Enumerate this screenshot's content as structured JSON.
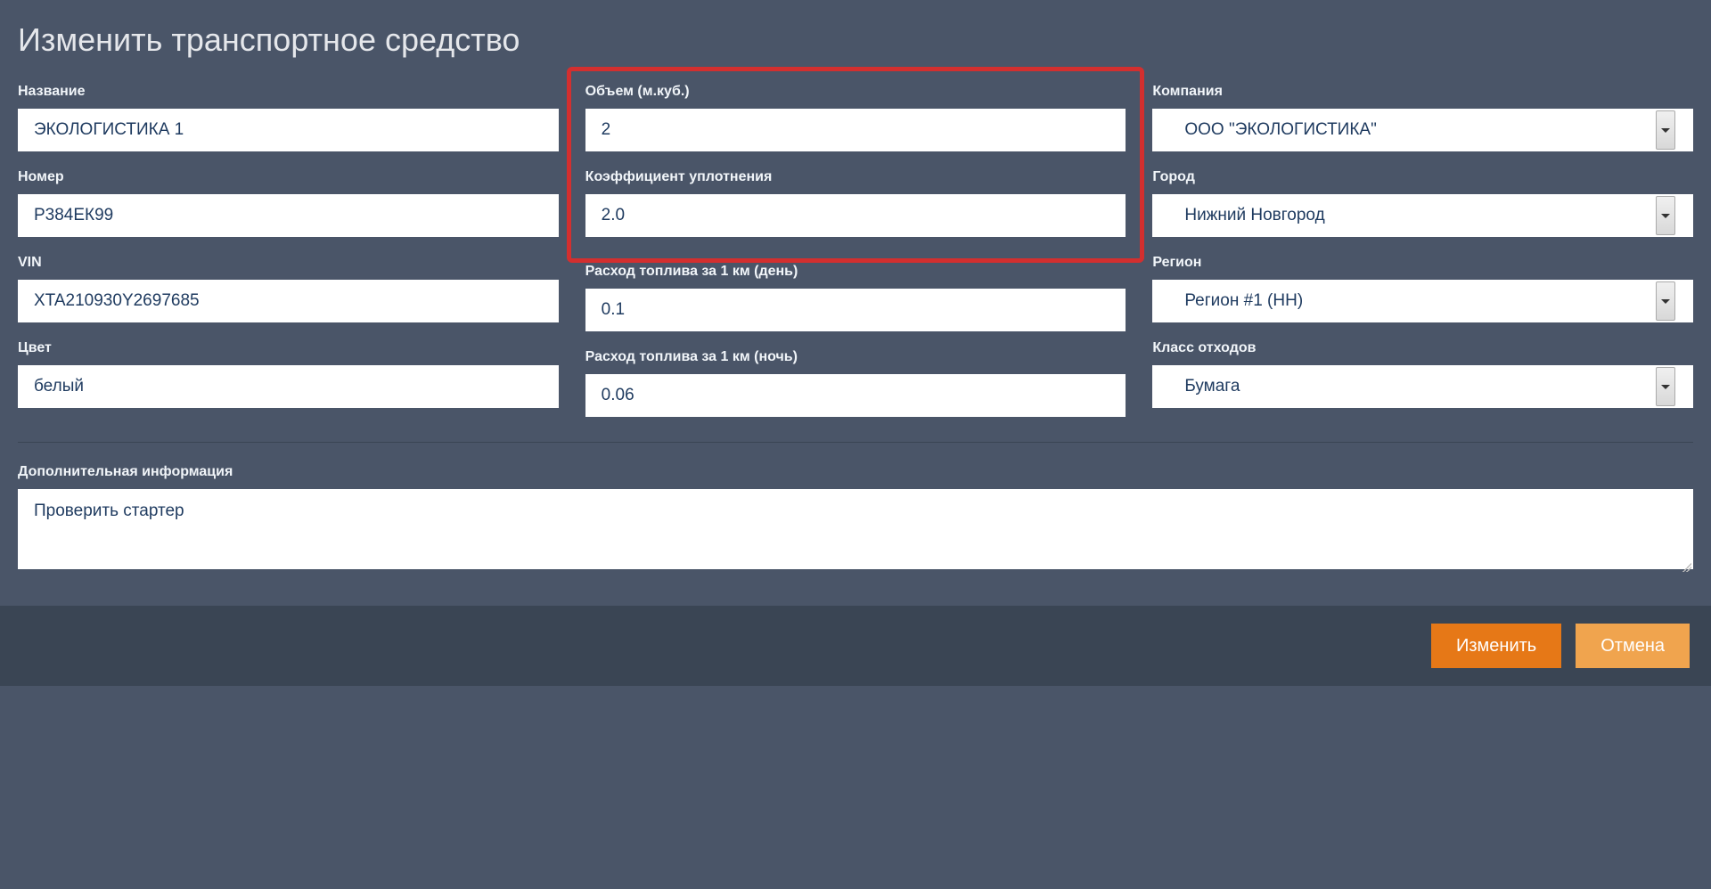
{
  "header": {
    "title": "Изменить транспортное средство"
  },
  "col1": {
    "name": {
      "label": "Название",
      "value": "ЭКОЛОГИСТИКА 1"
    },
    "number": {
      "label": "Номер",
      "value": "Р384ЕК99"
    },
    "vin": {
      "label": "VIN",
      "value": "XTA210930Y2697685"
    },
    "color": {
      "label": "Цвет",
      "value": "белый"
    }
  },
  "col2": {
    "volume": {
      "label": "Объем (м.куб.)",
      "value": "2"
    },
    "compaction": {
      "label": "Коэффициент уплотнения",
      "value": "2.0"
    },
    "fuelDay": {
      "label": "Расход топлива за 1 км (день)",
      "value": "0.1"
    },
    "fuelNight": {
      "label": "Расход топлива за 1 км (ночь)",
      "value": "0.06"
    }
  },
  "col3": {
    "company": {
      "label": "Компания",
      "value": "ООО \"ЭКОЛОГИСТИКА\""
    },
    "city": {
      "label": "Город",
      "value": "Нижний Новгород"
    },
    "region": {
      "label": "Регион",
      "value": "Регион #1 (НН)"
    },
    "wasteClass": {
      "label": "Класс отходов",
      "value": "Бумага"
    }
  },
  "additional": {
    "label": "Дополнительная информация",
    "value": "Проверить стартер"
  },
  "buttons": {
    "submit": "Изменить",
    "cancel": "Отмена"
  }
}
